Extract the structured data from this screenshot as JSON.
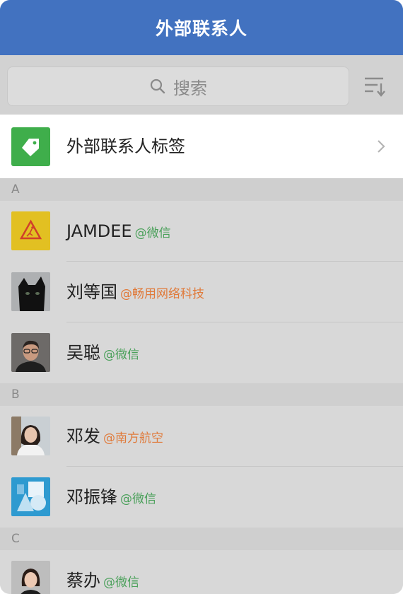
{
  "header": {
    "title": "外部联系人"
  },
  "search": {
    "placeholder": "搜索"
  },
  "tag_row": {
    "label": "外部联系人标签"
  },
  "colors": {
    "header_bg": "#4272c0",
    "wechat_tag": "#4aa05a",
    "company_tag": "#e07a3a",
    "tag_icon": "#3fae4b"
  },
  "sections": [
    {
      "letter": "A",
      "contacts": [
        {
          "name": "JAMDEE",
          "org": "@微信",
          "org_type": "wechat",
          "avatar": "warning-sign-avatar"
        },
        {
          "name": "刘等国",
          "org": "@畅用网络科技",
          "org_type": "company",
          "avatar": "black-cat-avatar"
        },
        {
          "name": "吴聪",
          "org": "@微信",
          "org_type": "wechat",
          "avatar": "man-glasses-avatar"
        }
      ]
    },
    {
      "letter": "B",
      "contacts": [
        {
          "name": "邓发",
          "org": "@南方航空",
          "org_type": "company",
          "avatar": "woman-portrait-avatar"
        },
        {
          "name": "邓振锋",
          "org": "@微信",
          "org_type": "wechat",
          "avatar": "shapes-avatar"
        }
      ]
    },
    {
      "letter": "C",
      "contacts": [
        {
          "name": "蔡办",
          "org": "@微信",
          "org_type": "wechat",
          "avatar": "woman-portrait-avatar-2"
        }
      ]
    }
  ]
}
